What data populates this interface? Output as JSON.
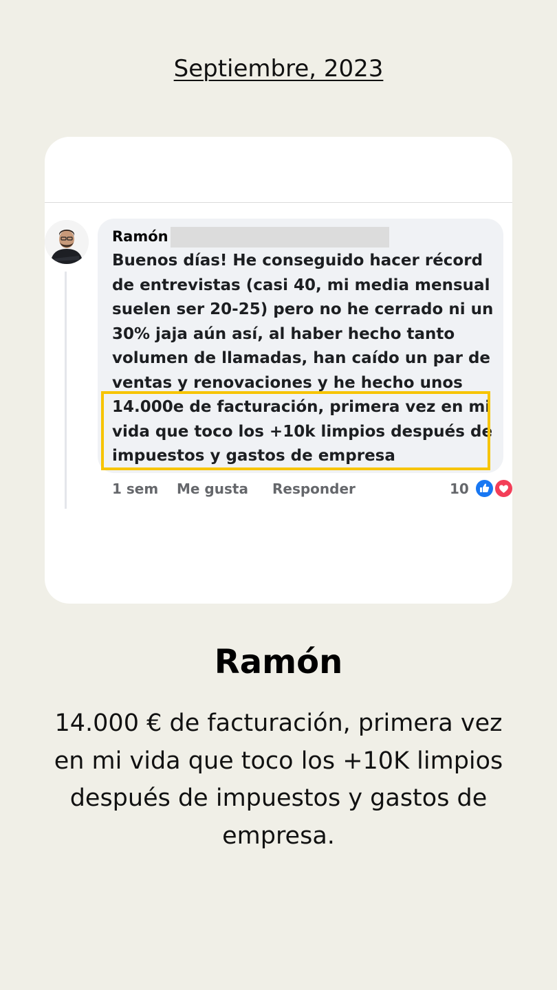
{
  "header": {
    "date": "Septiembre, 2023"
  },
  "comment": {
    "author": "Ramón",
    "message_lines": [
      "Buenos días! He conseguido hacer récord",
      "de entrevistas (casi 40, mi media mensual",
      "suelen ser 20-25) pero no he cerrado ni un",
      "30% jaja aún así, al haber hecho tanto",
      "volumen de llamadas, han caído un par de",
      "ventas y renovaciones y he hecho unos",
      "14.000e de facturación, primera vez en mi",
      "vida que toco los +10k limpios después de",
      "impuestos y gastos de empresa"
    ],
    "time": "1 sem",
    "like_label": "Me gusta",
    "reply_label": "Responder",
    "reaction_count": "10",
    "colors": {
      "highlight": "#f7c400",
      "like": "#1877f2",
      "love": "#f33e58"
    },
    "icons": [
      "avatar-photo",
      "like-reaction-icon",
      "love-reaction-icon"
    ]
  },
  "testimonial": {
    "name": "Ramón",
    "quote": "14.000 € de facturación, primera vez en mi vida que toco los +10K limpios después de impuestos y gastos de empresa."
  }
}
